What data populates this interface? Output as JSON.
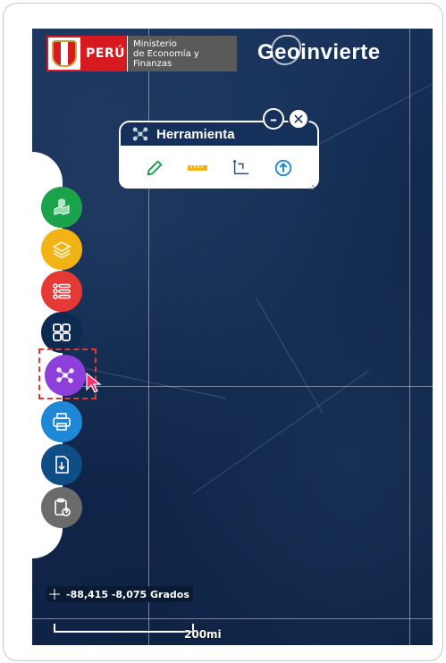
{
  "header": {
    "country": "PERÚ",
    "ministry_line1": "Ministerio",
    "ministry_line2": "de Economía y Finanzas",
    "brand": "Geoinvierte"
  },
  "sidebar": {
    "buttons": [
      {
        "name": "layers-map-button",
        "icon": "map-hand-icon",
        "color": "#1aa34a"
      },
      {
        "name": "layers-button",
        "icon": "stack-layers-icon",
        "color": "#f2b315"
      },
      {
        "name": "legend-list-button",
        "icon": "list-icon",
        "color": "#e53935"
      },
      {
        "name": "basemap-grid-button",
        "icon": "grid-icon",
        "color": "#0d2a50"
      },
      {
        "name": "tools-button",
        "icon": "nodes-icon",
        "color": "#8e3fd9",
        "selected": true
      },
      {
        "name": "print-button",
        "icon": "printer-icon",
        "color": "#1e88d6"
      },
      {
        "name": "download-button",
        "icon": "download-doc-icon",
        "color": "#0f4d86"
      },
      {
        "name": "help-button",
        "icon": "clipboard-help-icon",
        "color": "#6b6b6b"
      }
    ]
  },
  "tool_panel": {
    "title": "Herramienta",
    "minimize_label": "–",
    "close_label": "✕",
    "tools": [
      {
        "name": "draw-tool",
        "icon": "pencil-icon",
        "color": "#1aa34a"
      },
      {
        "name": "measure-tool",
        "icon": "ruler-icon",
        "color": "#f2b315"
      },
      {
        "name": "coordinates-tool",
        "icon": "axis-icon",
        "color": "#0f4d86"
      },
      {
        "name": "upload-tool",
        "icon": "upload-icon",
        "color": "#1e88d6"
      }
    ]
  },
  "status": {
    "coordinates": "-88,415 -8,075 Grados",
    "scale": "200mi"
  }
}
